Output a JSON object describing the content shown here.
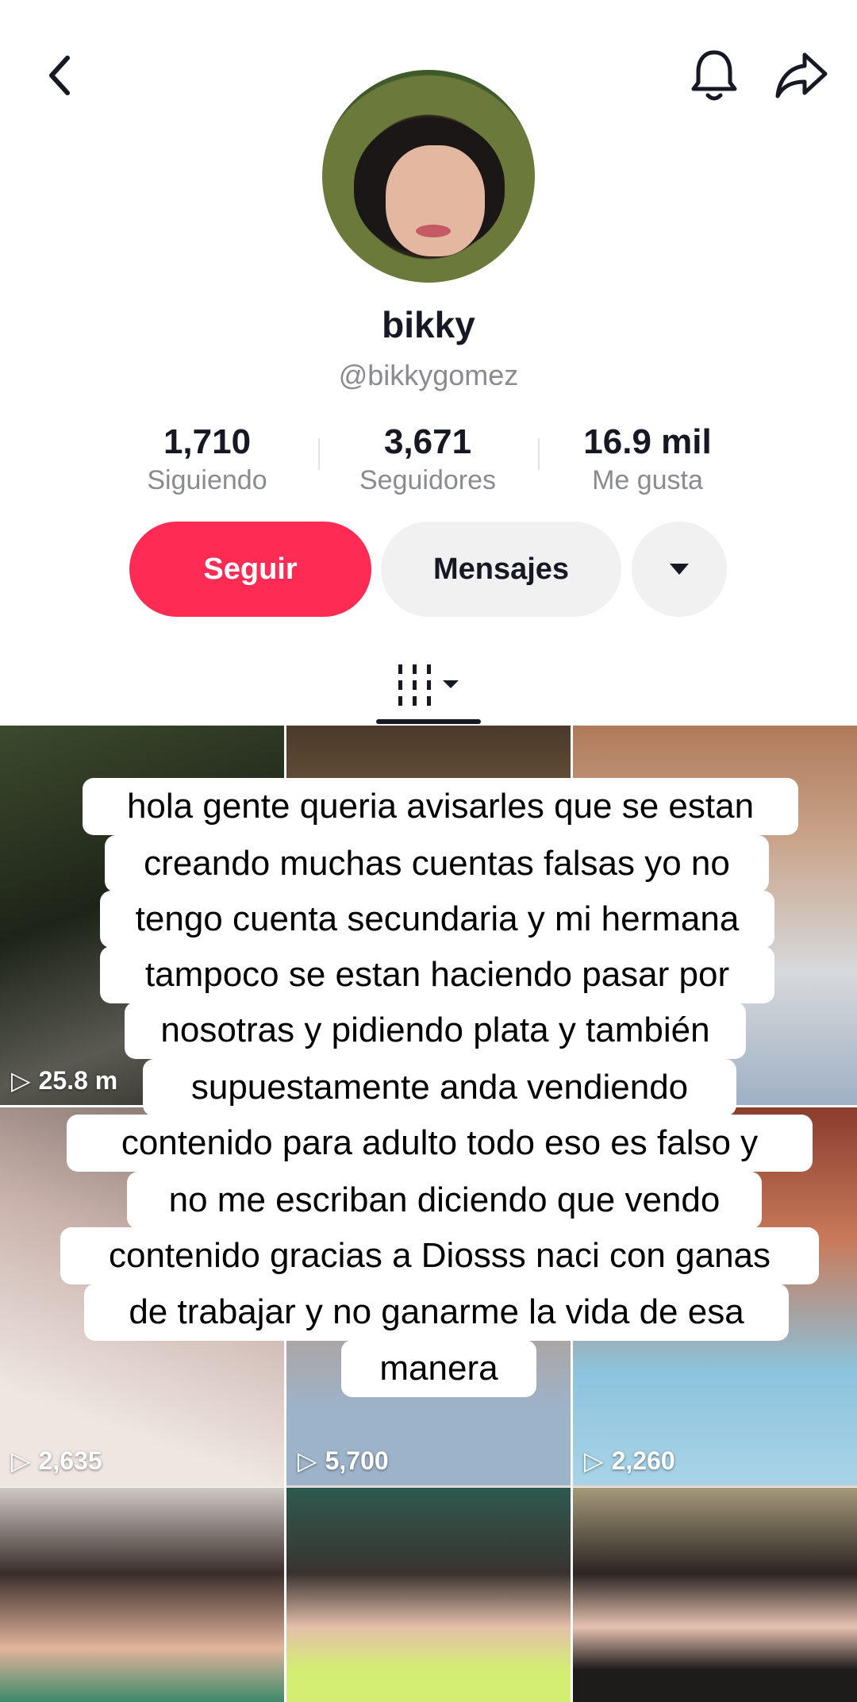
{
  "header": {
    "back_icon": "chevron-left-icon",
    "bell_icon": "bell-icon",
    "share_icon": "share-arrow-icon"
  },
  "profile": {
    "name": "bikky",
    "handle": "@bikkygomez"
  },
  "stats": [
    {
      "value": "1,710",
      "label": "Siguiendo"
    },
    {
      "value": "3,671",
      "label": "Seguidores"
    },
    {
      "value": "16.9 mil",
      "label": "Me gusta"
    }
  ],
  "actions": {
    "follow_label": "Seguir",
    "message_label": "Mensajes"
  },
  "colors": {
    "accent": "#fe2c55",
    "secondary_button": "#f1f1f2",
    "muted_text": "#8a8b91"
  },
  "videos": [
    {
      "views": "25.8 m"
    },
    {
      "views": ""
    },
    {
      "views": ""
    },
    {
      "views": ""
    },
    {
      "views": ""
    },
    {
      "views": ""
    },
    {
      "views": "2,635"
    },
    {
      "views": "5,700"
    },
    {
      "views": "2,260"
    },
    {
      "views": ""
    },
    {
      "views": ""
    },
    {
      "views": ""
    }
  ],
  "overlay_text": [
    "hola gente queria avisarles que se estan",
    "creando muchas cuentas falsas yo no",
    "tengo cuenta secundaria y mi hermana",
    "tampoco se estan haciendo pasar por",
    "nosotras y pidiendo plata y también",
    "supuestamente anda vendiendo",
    "contenido para adulto todo eso es falso y",
    "no me escriban diciendo que vendo",
    "contenido gracias a Diosss naci con ganas",
    "de trabajar y no ganarme la vida de esa",
    "manera"
  ]
}
